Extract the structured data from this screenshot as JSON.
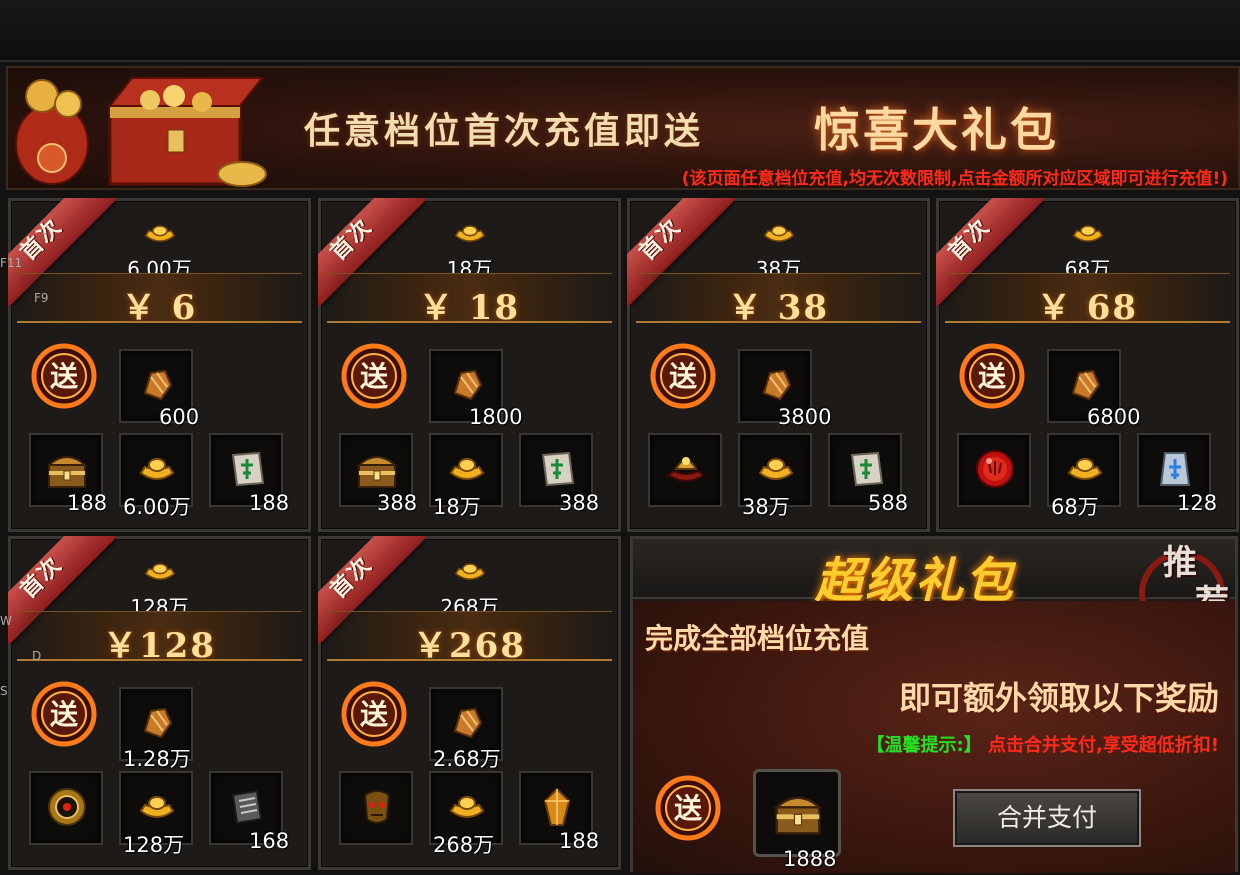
{
  "banner": {
    "title": "任意档位首次充值即送",
    "highlight": "惊喜大礼包",
    "note": "(该页面任意档位充值,均无次数限制,点击金额所对应区域即可进行充值!)"
  },
  "side_keys": [
    "F11",
    "F9",
    "W",
    "D",
    "S"
  ],
  "ribbon_label": "首次",
  "send_label": "送",
  "packs": [
    {
      "ingot": "6.00万",
      "price": "￥ 6",
      "main_qty": "600",
      "items": [
        {
          "icon": "treasure-chest-icon",
          "qty": "188"
        },
        {
          "icon": "gold-ingot-icon",
          "qty": "6.00万"
        },
        {
          "icon": "talisman-scroll-icon",
          "qty": "188"
        }
      ]
    },
    {
      "ingot": "18万",
      "price": "￥ 18",
      "main_qty": "1800",
      "items": [
        {
          "icon": "treasure-chest-icon",
          "qty": "388"
        },
        {
          "icon": "gold-ingot-icon",
          "qty": "18万"
        },
        {
          "icon": "talisman-scroll-icon",
          "qty": "388"
        }
      ]
    },
    {
      "ingot": "38万",
      "price": "￥ 38",
      "main_qty": "3800",
      "items": [
        {
          "icon": "warrior-helmet-icon",
          "qty": ""
        },
        {
          "icon": "gold-ingot-icon",
          "qty": "38万"
        },
        {
          "icon": "talisman-scroll-icon",
          "qty": "588"
        }
      ]
    },
    {
      "ingot": "68万",
      "price": "￥ 68",
      "main_qty": "6800",
      "items": [
        {
          "icon": "red-orb-icon",
          "qty": ""
        },
        {
          "icon": "gold-ingot-icon",
          "qty": "68万"
        },
        {
          "icon": "blue-rune-stone-icon",
          "qty": "128"
        }
      ]
    },
    {
      "ingot": "128万",
      "price": "￥128",
      "main_qty": "1.28万",
      "items": [
        {
          "icon": "golden-compass-icon",
          "qty": ""
        },
        {
          "icon": "gold-ingot-icon",
          "qty": "128万"
        },
        {
          "icon": "skill-book-icon",
          "qty": "168"
        }
      ]
    },
    {
      "ingot": "268万",
      "price": "￥268",
      "main_qty": "2.68万",
      "items": [
        {
          "icon": "demon-mask-icon",
          "qty": ""
        },
        {
          "icon": "gold-ingot-icon",
          "qty": "268万"
        },
        {
          "icon": "amber-crystal-icon",
          "qty": "188"
        }
      ]
    }
  ],
  "super_pack": {
    "title": "超级礼包",
    "recommend_a": "推",
    "recommend_b": "荐",
    "line1": "完成全部档位充值",
    "line2": "即可额外领取以下奖励",
    "tip_label": "【温馨提示:】",
    "tip_text": "点击合并支付,享受超低折扣!",
    "reward_qty": "1888",
    "button_label": "合并支付"
  }
}
